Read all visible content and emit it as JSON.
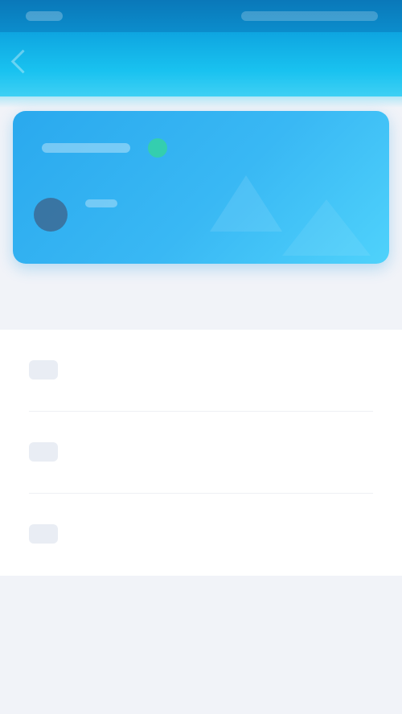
{
  "header": {
    "title": ""
  },
  "card": {
    "line": "",
    "sub": ""
  },
  "section": {
    "title": ""
  },
  "list": {
    "items": [
      {
        "label": "",
        "value": ""
      },
      {
        "label": "",
        "value": ""
      },
      {
        "label": "",
        "value": ""
      }
    ]
  }
}
